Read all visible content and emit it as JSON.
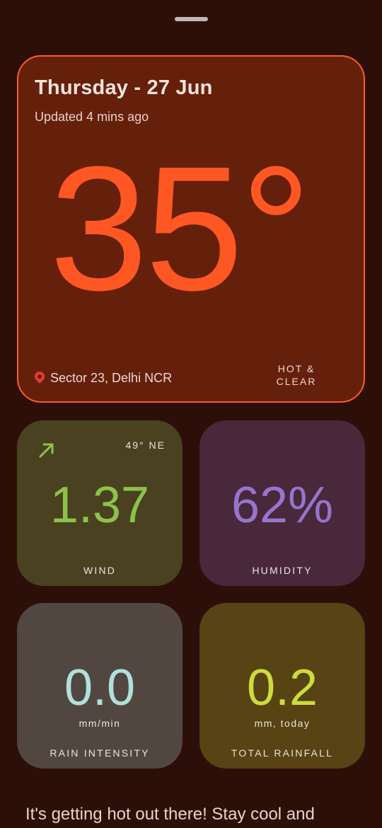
{
  "header": {
    "date": "Thursday - 27 Jun",
    "updated": "Updated 4 mins ago",
    "temperature": "35°",
    "location": "Sector 23, Delhi NCR",
    "condition": "HOT & CLEAR",
    "location_icon": "map-pin-icon"
  },
  "tiles": {
    "wind": {
      "value": "1.37",
      "direction": "49° NE",
      "label": "WIND",
      "icon": "wind-direction-arrow-icon"
    },
    "humidity": {
      "value": "62%",
      "label": "HUMIDITY"
    },
    "rain_intensity": {
      "value": "0.0",
      "unit": "mm/min",
      "label": "RAIN INTENSITY"
    },
    "total_rainfall": {
      "value": "0.2",
      "unit": "mm, today",
      "label": "TOTAL RAINFALL"
    }
  },
  "advice": "It's getting hot out there! Stay cool and",
  "colors": {
    "background": "#2d0f09",
    "temperature": "#ff5724",
    "wind": "#8bc34a",
    "humidity": "#9575cd",
    "rain_intensity": "#b2dfdb",
    "total_rainfall": "#cddc39"
  }
}
